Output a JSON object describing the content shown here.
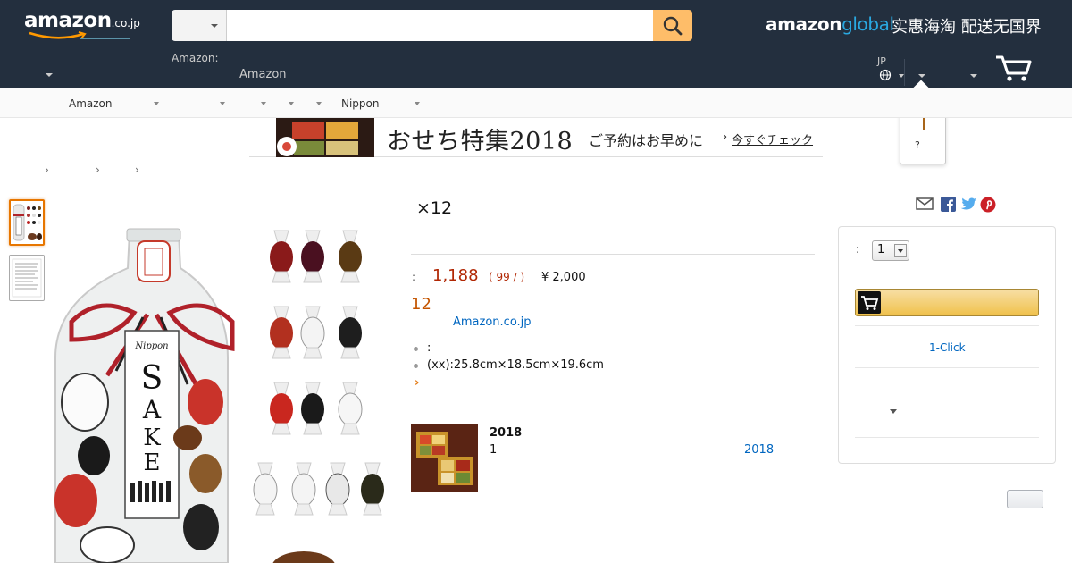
{
  "header": {
    "logo_word": "amazon",
    "logo_tld": ".co.jp",
    "global_logo_main": "amazon",
    "global_logo_accent": "global",
    "global_tagline": "实惠海淘 配送无国界",
    "deliver_small": "Amazon:",
    "deliver_big": "Amazon",
    "language": "JP",
    "popover_text": "?",
    "search": {
      "value": ""
    }
  },
  "subnav": {
    "items": [
      "Amazon",
      "Nippon"
    ]
  },
  "banner": {
    "title": "おせち特集2018",
    "subtitle": "ご予約はお早めに",
    "cta": "今すぐチェック",
    "cta_chevron": "›"
  },
  "breadcrumb": {
    "separators": [
      "›",
      "›",
      "›"
    ]
  },
  "product": {
    "title": "×12",
    "price_label": ":",
    "price": "1,188",
    "price_per_unit": "( 99 /  )",
    "list_price": "¥ 2,000",
    "stock": "12",
    "seller": "Amazon.co.jp",
    "bullets": [
      ":",
      "(xx):25.8cm×18.5cm×19.6cm"
    ],
    "more": "›"
  },
  "related": {
    "title": "2018",
    "quantity": "1",
    "link": "2018"
  },
  "buybox": {
    "qty_label": ":",
    "qty_value": "1",
    "one_click": "1-Click"
  },
  "colors": {
    "header_bg": "#232f3e",
    "search_button": "#febd69",
    "price_red": "#b12704",
    "stock_orange": "#c45500",
    "link_blue": "#0066c0",
    "cart_button": "#f0c14b"
  }
}
